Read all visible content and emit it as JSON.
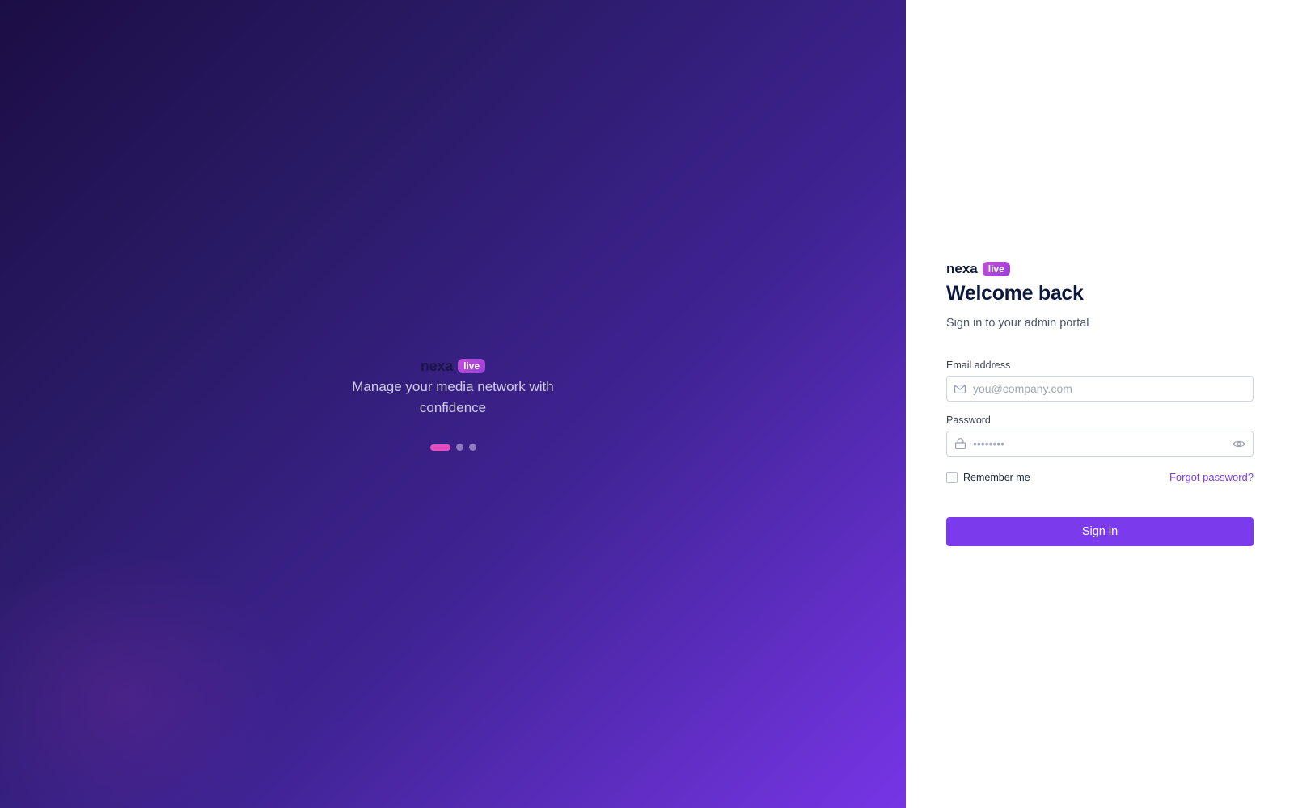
{
  "brand": {
    "name": "nexa",
    "badge": "live"
  },
  "hero": {
    "tagline": "Manage your media network with confidence",
    "slides": {
      "count": 3,
      "active": 1
    }
  },
  "login": {
    "title": "Welcome back",
    "subtitle": "Sign in to your admin portal",
    "email": {
      "label": "Email address",
      "placeholder": "you@company.com",
      "value": ""
    },
    "password": {
      "label": "Password",
      "placeholder": "••••••••",
      "value": ""
    },
    "remember_label": "Remember me",
    "remember_checked": false,
    "forgot_label": "Forgot password?",
    "submit_label": "Sign in"
  },
  "icons": {
    "email": "mail-icon",
    "password": "lock-icon",
    "toggle": "eye-icon"
  },
  "colors": {
    "accent": "#7c3aed",
    "badge": "#b14ad8",
    "dot_active": "#e14fbf",
    "text_dark": "#0e1a3b"
  }
}
